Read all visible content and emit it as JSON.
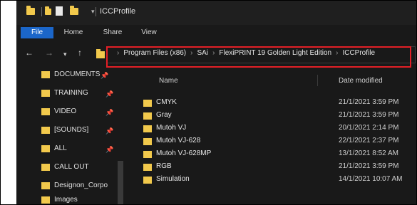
{
  "window": {
    "title": "ICCProfile"
  },
  "ribbon": {
    "tabs": [
      "File",
      "Home",
      "Share",
      "View"
    ]
  },
  "address": {
    "back_glyph": "←",
    "forward_glyph": "→",
    "recent_glyph": "▾",
    "up_glyph": "↑",
    "separator": "›",
    "crumbs": [
      "Program Files (x86)",
      "SAi",
      "FlexiPRINT 19 Golden Light Edition",
      "ICCProfile"
    ],
    "highlight_color": "#e31f26"
  },
  "nav_pane": {
    "pin_glyph": "📌",
    "items": [
      {
        "label": "DOCUMENTS",
        "pinned": true
      },
      {
        "label": "TRAINING",
        "pinned": true
      },
      {
        "label": "VIDEO",
        "pinned": true
      },
      {
        "label": "[SOUNDS]",
        "pinned": true
      },
      {
        "label": "ALL",
        "pinned": true
      },
      {
        "label": "CALL OUT",
        "pinned": false
      },
      {
        "label": "Designon_Corpo",
        "pinned": false
      },
      {
        "label": "Images",
        "pinned": false
      }
    ]
  },
  "content": {
    "headers": {
      "name": "Name",
      "date": "Date modified"
    },
    "rows": [
      {
        "name": "CMYK",
        "date": "21/1/2021 3:59 PM"
      },
      {
        "name": "Gray",
        "date": "21/1/2021 3:59 PM"
      },
      {
        "name": "Mutoh VJ",
        "date": "20/1/2021 2:14 PM"
      },
      {
        "name": "Mutoh VJ-628",
        "date": "22/1/2021 2:37 PM"
      },
      {
        "name": "Mutoh VJ-628MP",
        "date": "13/1/2021 8:52 AM"
      },
      {
        "name": "RGB",
        "date": "21/1/2021 3:59 PM"
      },
      {
        "name": "Simulation",
        "date": "14/1/2021 10:07 AM"
      }
    ]
  },
  "colors": {
    "folder": "#f2c94c",
    "file_tab": "#1b66c9",
    "background": "#191919"
  }
}
